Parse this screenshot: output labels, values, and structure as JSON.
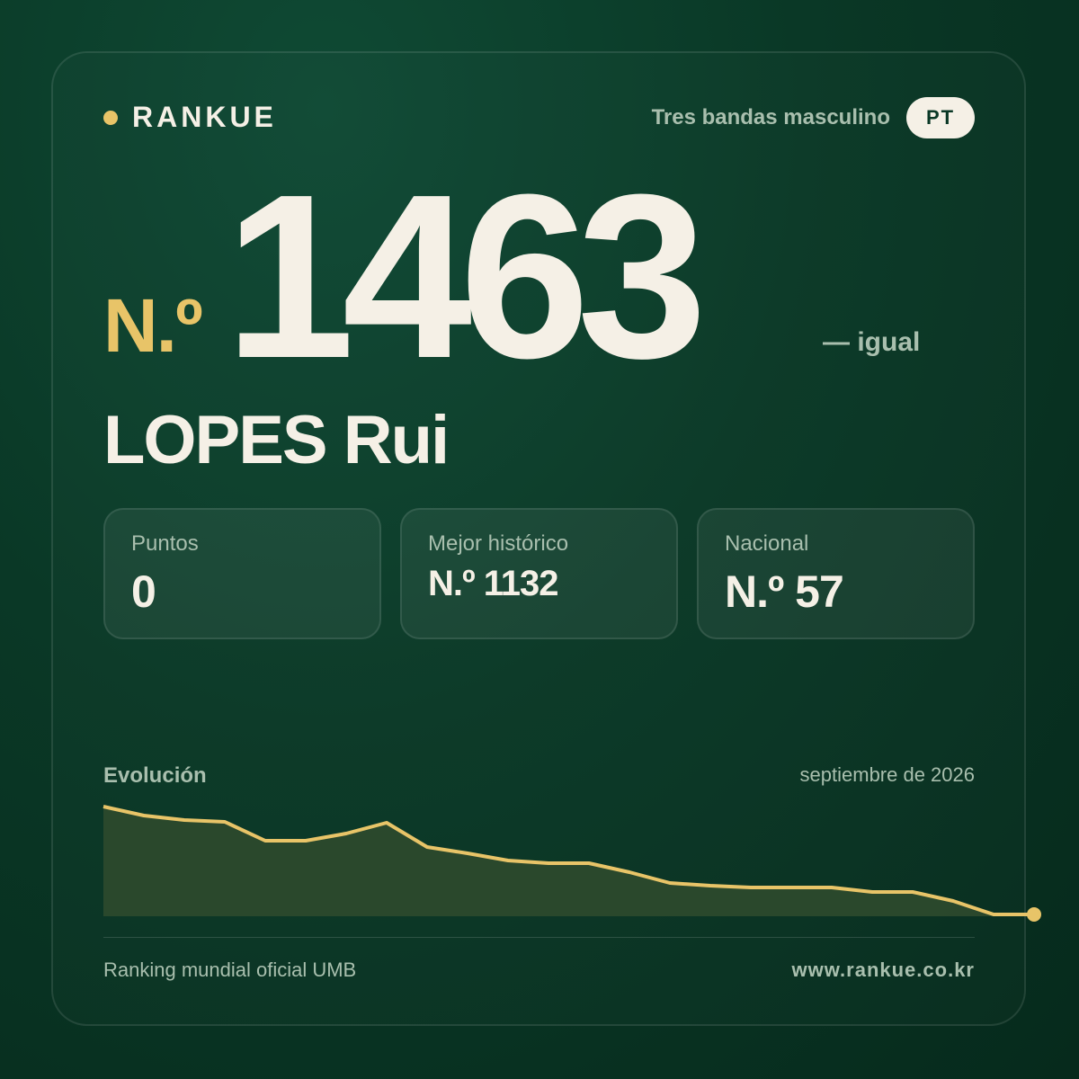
{
  "brand": {
    "name": "RANKUE",
    "accent_color": "#e8c468"
  },
  "header": {
    "category": "Tres bandas masculino",
    "country_code": "PT"
  },
  "rank": {
    "prefix": "N.º",
    "number": "1463",
    "change": "— igual"
  },
  "player": {
    "name": "LOPES Rui"
  },
  "stats": [
    {
      "label": "Puntos",
      "value": "0"
    },
    {
      "label": "Mejor histórico",
      "value": "N.º 1132"
    },
    {
      "label": "Nacional",
      "value": "N.º 57"
    }
  ],
  "chart": {
    "title": "Evolución",
    "date": "septiembre de 2026"
  },
  "chart_data": {
    "type": "area",
    "title": "",
    "xlabel": "",
    "ylabel": "",
    "grid": false,
    "line_color": "#e8c468",
    "fill_color": "#2e4a2e",
    "y_note": "relative level of the ranking line, 0 = bottom, 1 = top",
    "values": [
      1.0,
      0.9,
      0.85,
      0.83,
      0.62,
      0.62,
      0.7,
      0.82,
      0.55,
      0.48,
      0.4,
      0.37,
      0.37,
      0.27,
      0.15,
      0.12,
      0.1,
      0.1,
      0.1,
      0.05,
      0.05,
      -0.05,
      -0.2,
      -0.2
    ],
    "end_marker": true
  },
  "footer": {
    "source": "Ranking mundial oficial UMB",
    "website": "www.rankue.co.kr"
  }
}
